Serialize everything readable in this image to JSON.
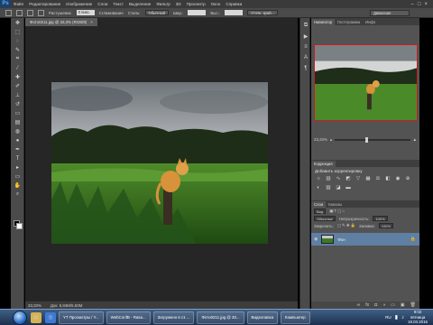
{
  "menubar": {
    "logo": "Ps",
    "items": [
      "Файл",
      "Редактирование",
      "Изображение",
      "Слои",
      "Текст",
      "Выделение",
      "Фильтр",
      "3D",
      "Просмотр",
      "Окно",
      "Справка"
    ]
  },
  "options": {
    "feather_label": "Растушевка:",
    "feather_value": "0 пикс.",
    "antialias_label": "Сглаживание",
    "style_label": "Стиль:",
    "style_value": "Обычный",
    "width_label": "Шир.:",
    "height_label": "Выс.:",
    "refine_label": "Уточн. край...",
    "workspace": "Движение"
  },
  "document": {
    "tab_title": "Фото0211.jpg @ 33,3% (RGB/8)",
    "status_zoom": "33,33%",
    "status_doc": "Док: 5,93М/5,93М"
  },
  "panels": {
    "nav_tabs": [
      "Навигатор",
      "Гистограмма",
      "Инфо"
    ],
    "zoom_percent": "33,33%",
    "adj_tabs": [
      "Коррекция"
    ],
    "adj_title": "Добавить корректировку",
    "layers_tabs": [
      "Слои",
      "Каналы"
    ],
    "layers_kind": "Вид",
    "blend_mode": "Обычные",
    "opacity_label": "Непрозрачность:",
    "opacity_value": "100%",
    "lock_label": "Закрепить:",
    "fill_label": "Заливка:",
    "fill_value": "100%",
    "layer_name": "Фон"
  },
  "taskbar": {
    "buttons": [
      "YT Просмотры / Y...",
      "WebConfB - Rasa...",
      "Загружено в с1 ...",
      "Фото0211.jpg @ 33...",
      "Видеопапка",
      "Компьютер"
    ],
    "lang": "RU",
    "time": "9:02",
    "day": "пятница",
    "date": "18.03.2016"
  },
  "colors": {
    "accent": "#5f7fa3",
    "nav_frame": "#c81e1e"
  }
}
